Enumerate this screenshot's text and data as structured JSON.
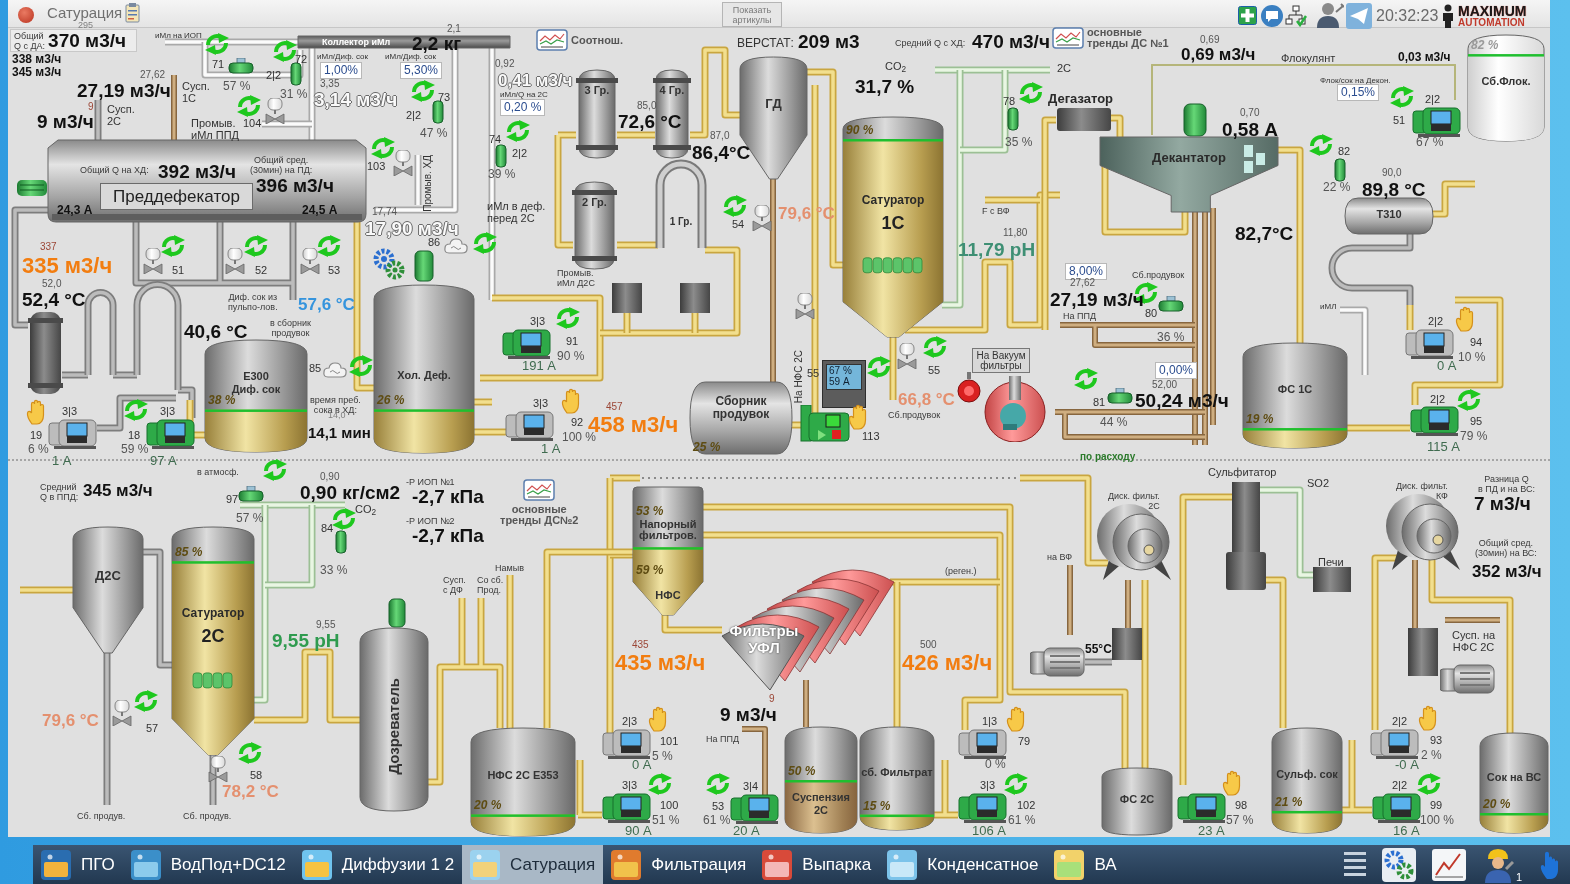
{
  "window": {
    "title": "Сатурация"
  },
  "header": {
    "articles_button": "Показать\nартикулы",
    "clock": "20:32:23",
    "logo": {
      "line_1": "MAXIMUM",
      "line_2": "AUTOMATION"
    }
  },
  "flow_panel": {
    "label": "Общий\nQ с ДА:",
    "value": "370 м3/ч"
  },
  "trend_buttons": [
    {
      "label": "Соотнош."
    },
    {
      "label": "основные\nтренды ДС №1"
    },
    {
      "label": "основные\nтренды ДС№2"
    }
  ],
  "vacuum_button": "На Вакуум\nфильтры",
  "labels": [
    {
      "text": "295",
      "kind": "ghost"
    },
    {
      "text": "338 м3/ч",
      "kind": "bold_small"
    },
    {
      "text": "345 м3/ч",
      "kind": "bold_small"
    },
    {
      "text": "иМл на ИОП",
      "kind": "tiny"
    },
    {
      "text": "2,1",
      "kind": "setpoint"
    },
    {
      "text": "2,2 кг",
      "kind": "value"
    },
    {
      "text": "иМл/Диф. сок",
      "kind": "tiny"
    },
    {
      "text": "1,00%",
      "kind": "ratio_box"
    },
    {
      "text": "иМл/Диф. сок",
      "kind": "tiny"
    },
    {
      "text": "5,30%",
      "kind": "ratio_box"
    },
    {
      "text": "3,35",
      "kind": "setpoint"
    },
    {
      "text": "3,14 м3/ч",
      "kind": "value_white"
    },
    {
      "text": "0,92",
      "kind": "setpoint"
    },
    {
      "text": "0,41 м3/ч",
      "kind": "value_white_medium"
    },
    {
      "text": "иМл/Q на 2С",
      "kind": "tiny"
    },
    {
      "text": "0,20 %",
      "kind": "ratio_box"
    },
    {
      "text": "27,62",
      "kind": "setpoint"
    },
    {
      "text": "27,19 м3/ч",
      "kind": "value"
    },
    {
      "text": "9",
      "kind": "setpoint_red"
    },
    {
      "text": "Сусп.\n1С",
      "kind": "caption"
    },
    {
      "text": "9 м3/ч",
      "kind": "value"
    },
    {
      "text": "Сусп.\n2С",
      "kind": "caption"
    },
    {
      "text": "Промыв.\nиМл ППД",
      "kind": "caption"
    },
    {
      "text": "Общий Q на ХД:",
      "kind": "note"
    },
    {
      "text": "392 м3/ч",
      "kind": "value"
    },
    {
      "text": "Общий сред.\n(30мин) на ПД:",
      "kind": "note"
    },
    {
      "text": "396 м3/ч",
      "kind": "value"
    },
    {
      "text": "24,3 А",
      "kind": "bold_small"
    },
    {
      "text": "24,5 А",
      "kind": "bold_small"
    },
    {
      "text": "Промыв. ХД",
      "kind": "vertical"
    },
    {
      "text": "17,74",
      "kind": "setpoint"
    },
    {
      "text": "17,90 м3/ч",
      "kind": "value_white"
    },
    {
      "text": "иМл в деф.\nперед 2С",
      "kind": "caption"
    },
    {
      "text": "337",
      "kind": "setpoint_red"
    },
    {
      "text": "335 м3/ч",
      "kind": "flow_orange"
    },
    {
      "text": "52,0",
      "kind": "setpoint"
    },
    {
      "text": "52,4 °С",
      "kind": "value"
    },
    {
      "text": "Диф. сок из\nпульпо-лов.",
      "kind": "note"
    },
    {
      "text": "57,6 °С",
      "kind": "temp_blue"
    },
    {
      "text": "40,6 °С",
      "kind": "value"
    },
    {
      "text": "в сборник\nпродувок",
      "kind": "note"
    },
    {
      "text": "время преб.\nсока в ХД:",
      "kind": "note"
    },
    {
      "text": "14,0",
      "kind": "ghost"
    },
    {
      "text": "14,1 мин",
      "kind": "value_small"
    },
    {
      "text": "ВЕРСТАТ:",
      "kind": "label"
    },
    {
      "text": "209 м3",
      "kind": "value"
    },
    {
      "text": "Средний Q с ХД:",
      "kind": "note"
    },
    {
      "text": "470 м3/ч",
      "kind": "value"
    },
    {
      "text": "CO$_{2}$",
      "kind": "caption"
    },
    {
      "text": "31,7 %",
      "kind": "value"
    },
    {
      "text": "85,0",
      "kind": "setpoint"
    },
    {
      "text": "72,6 °С",
      "kind": "value"
    },
    {
      "text": "87,0",
      "kind": "setpoint"
    },
    {
      "text": "86,4°С",
      "kind": "value"
    },
    {
      "text": "79,6 °С",
      "kind": "temp_salmon"
    },
    {
      "text": "Промыв.\nиМл Д2С",
      "kind": "note"
    },
    {
      "text": "457",
      "kind": "setpoint_red"
    },
    {
      "text": "458 м3/ч",
      "kind": "flow_orange"
    },
    {
      "text": "На НФС 2С",
      "kind": "vertical"
    },
    {
      "text": "66,8 °С",
      "kind": "temp_salmon"
    },
    {
      "text": "Сб.продувок",
      "kind": "note"
    },
    {
      "text": "F с ВФ",
      "kind": "note"
    },
    {
      "text": "11,80",
      "kind": "setpoint"
    },
    {
      "text": "11,79 pH",
      "kind": "ph_teal"
    },
    {
      "text": "2С",
      "kind": "caption"
    },
    {
      "text": "Дегазатор",
      "kind": "title_small"
    },
    {
      "text": "0,69",
      "kind": "setpoint"
    },
    {
      "text": "0,69 м3/ч",
      "kind": "value_medium"
    },
    {
      "text": "Флокулянт",
      "kind": "caption"
    },
    {
      "text": "0,03 м3/ч",
      "kind": "bold_small"
    },
    {
      "text": "Флок/сок на Декон.",
      "kind": "tiny"
    },
    {
      "text": "0,15%",
      "kind": "ratio_box"
    },
    {
      "text": "0,70",
      "kind": "setpoint"
    },
    {
      "text": "0,58 А",
      "kind": "value"
    },
    {
      "text": "90,0",
      "kind": "setpoint"
    },
    {
      "text": "89,8 °С",
      "kind": "value"
    },
    {
      "text": "82,7°С",
      "kind": "value"
    },
    {
      "text": "8,00%",
      "kind": "ratio_box"
    },
    {
      "text": "Сб.продувок",
      "kind": "note"
    },
    {
      "text": "27,62",
      "kind": "setpoint"
    },
    {
      "text": "27,19 м3/ч",
      "kind": "value"
    },
    {
      "text": "На ППД",
      "kind": "note"
    },
    {
      "text": "иМЛ",
      "kind": "tiny"
    },
    {
      "text": "0,00%",
      "kind": "ratio_box"
    },
    {
      "text": "52,00",
      "kind": "setpoint"
    },
    {
      "text": "50,24 м3/ч",
      "kind": "value"
    },
    {
      "text": "по расходу",
      "kind": "status"
    },
    {
      "text": "в атмосф.",
      "kind": "note"
    },
    {
      "text": "Средний\nQ в ППД:",
      "kind": "note"
    },
    {
      "text": "345 м3/ч",
      "kind": "value_medium"
    },
    {
      "text": "0,90",
      "kind": "setpoint"
    },
    {
      "text": "0,90 кг/см2",
      "kind": "value"
    },
    {
      "text": "CO$_{2}$",
      "kind": "caption"
    },
    {
      "text": "-Р ИОП №1",
      "kind": "note"
    },
    {
      "text": "-2,7 кПа",
      "kind": "value"
    },
    {
      "text": "-Р ИОП №2",
      "kind": "note"
    },
    {
      "text": "-2,7 кПа",
      "kind": "value"
    },
    {
      "text": "9,55",
      "kind": "setpoint"
    },
    {
      "text": "9,55 pH",
      "kind": "ph_green"
    },
    {
      "text": "79,6 °С",
      "kind": "temp_salmon"
    },
    {
      "text": "78,2 °С",
      "kind": "temp_salmon"
    },
    {
      "text": "Сб. продув.",
      "kind": "note"
    },
    {
      "text": "Сб. продув.",
      "kind": "note"
    },
    {
      "text": "Сусп.\nс ДФ",
      "kind": "note"
    },
    {
      "text": "Со сб.\nПрод.",
      "kind": "note"
    },
    {
      "text": "Намыв",
      "kind": "note"
    },
    {
      "text": "(реген.)",
      "kind": "note"
    },
    {
      "text": "435",
      "kind": "setpoint_red"
    },
    {
      "text": "435 м3/ч",
      "kind": "flow_orange"
    },
    {
      "text": "500",
      "kind": "setpoint"
    },
    {
      "text": "426 м3/ч",
      "kind": "flow_orange"
    },
    {
      "text": "9",
      "kind": "setpoint_red"
    },
    {
      "text": "9 м3/ч",
      "kind": "value"
    },
    {
      "text": "На ППД",
      "kind": "note"
    },
    {
      "text": "Сульфитатор",
      "kind": "caption"
    },
    {
      "text": "SO2",
      "kind": "caption"
    },
    {
      "text": "Печи",
      "kind": "caption"
    },
    {
      "text": "Диск. фильт.\n2С",
      "kind": "note"
    },
    {
      "text": "на ВФ",
      "kind": "note"
    },
    {
      "text": "55°С",
      "kind": "bold_small"
    },
    {
      "text": "Диск. фильт.\nКФ",
      "kind": "note"
    },
    {
      "text": "Разница Q\nв ПД и на ВС:",
      "kind": "note"
    },
    {
      "text": "7 м3/ч",
      "kind": "value"
    },
    {
      "text": "Общий сред.\n(30мин) на ВС:",
      "kind": "note"
    },
    {
      "text": "352 м3/ч",
      "kind": "value_medium"
    },
    {
      "text": "Сусп. на\nНФС 2С",
      "kind": "caption"
    }
  ],
  "vessels": [
    {
      "kind": "predefecator",
      "name": "Преддефекатор"
    },
    {
      "kind": "collector",
      "name": "Коллектор иМл"
    },
    {
      "kind": "tank",
      "name": "E300\nДиф. сок",
      "level_text": "38 %",
      "level": 0.38
    },
    {
      "kind": "tank",
      "name": "Хол. Деф.",
      "level_text": "26 %",
      "level": 0.26
    },
    {
      "kind": "heater",
      "name": "3 Гр."
    },
    {
      "kind": "heater",
      "name": "4 Гр."
    },
    {
      "kind": "heater",
      "name": "2 Гр."
    },
    {
      "kind": "u_tube",
      "name": "1 Гр."
    },
    {
      "kind": "cone",
      "name": "ГД"
    },
    {
      "kind": "saturator",
      "name": "Сатуратор",
      "subtitle": "1С",
      "level_text": "90 %",
      "level": 0.9
    },
    {
      "kind": "horizontal",
      "name": "Сборник\nпродувок",
      "level_text": "25 %"
    },
    {
      "kind": "decanter",
      "name": "Декантатор"
    },
    {
      "kind": "exchanger",
      "name": "Т310"
    },
    {
      "kind": "reagent_tank",
      "name": "Сб.Флок.",
      "level_text": "82 %",
      "level": 0.82
    },
    {
      "kind": "tank",
      "name": "ФС 1С",
      "level_text": "19 %",
      "level": 0.19
    },
    {
      "kind": "cone",
      "name": "Д2С"
    },
    {
      "kind": "saturator",
      "name": "Сатуратор",
      "subtitle": "2С",
      "level_text": "85 %",
      "level": 0.85
    },
    {
      "kind": "vertical_tank",
      "name": "Дозреватель"
    },
    {
      "kind": "tank",
      "name": "НФС 2С Е353",
      "level_text": "20 %",
      "level": 0.2
    },
    {
      "kind": "pressure_filter",
      "name": "Напорный\nфильтров.",
      "level_text": "53 %",
      "level": 0.53,
      "lower_name": "НФС",
      "lower_level_text": "59 %"
    },
    {
      "kind": "leaf_filters",
      "name": "Фильтры\nУФЛ"
    },
    {
      "kind": "slurry_tank",
      "name": "Суспензия\n2С",
      "level_text": "50 %",
      "level": 0.5
    },
    {
      "kind": "tank",
      "name": "сб. Фильтрат",
      "level_text": "15 %",
      "level": 0.15
    },
    {
      "kind": "tank",
      "name": "ФС 2С"
    },
    {
      "kind": "tank",
      "name": "Сульф. сок",
      "level_text": "21 %",
      "level": 0.21
    },
    {
      "kind": "tank",
      "name": "Сок на ВС",
      "level_text": "20 %",
      "level": 0.2
    }
  ],
  "pumps": [
    {
      "kind": "pump",
      "mode": "3|3",
      "number": "19",
      "output": "6 %",
      "current": "1 А",
      "running": false,
      "auto": false
    },
    {
      "kind": "pump",
      "mode": "3|3",
      "number": "18",
      "output": "59 %",
      "current": "97 А",
      "running": true,
      "auto": true
    },
    {
      "kind": "pump",
      "mode": "3|3",
      "number": "91",
      "output": "90 %",
      "current": "191 А",
      "running": true,
      "auto": true
    },
    {
      "kind": "pump",
      "mode": "3|3",
      "number": "92",
      "output": "100 %",
      "current": "1 А",
      "running": false,
      "auto": false
    },
    {
      "kind": "drive",
      "number": "113",
      "display_output": "67 %",
      "display_current": "59 А",
      "running": true,
      "auto": false
    },
    {
      "kind": "pump",
      "mode": "2|2",
      "number": "51",
      "output": "67 %",
      "running": true,
      "auto": true
    },
    {
      "kind": "pump",
      "mode": "2|2",
      "number": "94",
      "output": "10 %",
      "current": "0 А",
      "running": false,
      "auto": false
    },
    {
      "kind": "pump",
      "mode": "2|2",
      "number": "95",
      "output": "79 %",
      "current": "115 А",
      "running": true,
      "auto": true
    },
    {
      "kind": "pump",
      "mode": "2|3",
      "number": "101",
      "output": "5 %",
      "current": "0 А",
      "running": false,
      "auto": false
    },
    {
      "kind": "pump",
      "mode": "3|3",
      "number": "100",
      "output": "51 %",
      "current": "90 А",
      "running": true,
      "auto": true
    },
    {
      "kind": "pump",
      "mode": "3|4",
      "number": "53",
      "output": "61 %",
      "current": "20 А",
      "running": true,
      "auto": true
    },
    {
      "kind": "pump",
      "mode": "1|3",
      "number": "79",
      "output": "0 %",
      "running": false,
      "auto": false
    },
    {
      "kind": "pump",
      "mode": "3|3",
      "number": "102",
      "output": "61 %",
      "current": "106 А",
      "running": true,
      "auto": true
    },
    {
      "kind": "pump",
      "number": "98",
      "output": "57 %",
      "current": "23 А",
      "running": true,
      "auto": false
    },
    {
      "kind": "pump",
      "mode": "2|2",
      "number": "93",
      "output": "2 %",
      "current": "-0 А",
      "running": false,
      "auto": false
    },
    {
      "kind": "pump",
      "mode": "2|2",
      "number": "99",
      "output": "100 %",
      "current": "16 А",
      "running": true,
      "auto": true
    }
  ],
  "valves": [
    {
      "kind": "flowmeter",
      "number": "71",
      "percent": "57 %",
      "auto": true
    },
    {
      "kind": "flowmeter_vertical",
      "mode": "2|2",
      "number": "72",
      "percent": "31 %",
      "auto": true
    },
    {
      "kind": "flowmeter_vertical",
      "mode": "2|2",
      "number": "73",
      "percent": "47 %",
      "auto": true
    },
    {
      "kind": "flowmeter_vertical",
      "mode": "2|2",
      "number": "74",
      "percent": "39 %",
      "auto": true
    },
    {
      "kind": "valve",
      "number": "104",
      "auto": true
    },
    {
      "kind": "valve",
      "number": "103",
      "auto": true
    },
    {
      "kind": "valve",
      "number": "51",
      "auto": true
    },
    {
      "kind": "valve",
      "number": "52",
      "auto": true
    },
    {
      "kind": "valve",
      "number": "53",
      "auto": true
    },
    {
      "kind": "sensor",
      "number": "86",
      "auto": true
    },
    {
      "kind": "sensor",
      "number": "85",
      "auto": true
    },
    {
      "kind": "valve",
      "number": "54",
      "auto": true
    },
    {
      "kind": "valve",
      "number": "55",
      "auto": true
    },
    {
      "kind": "valve",
      "number": "55",
      "auto": true
    },
    {
      "kind": "flowmeter_vertical",
      "number": "78",
      "percent": "35 %",
      "auto": true
    },
    {
      "kind": "flowmeter_vertical",
      "number": "82",
      "percent": "22 %",
      "auto": true
    },
    {
      "kind": "flowmeter",
      "number": "80",
      "percent": "36 %",
      "auto": true
    },
    {
      "kind": "flowmeter",
      "number": "81",
      "percent": "44 %",
      "auto": true
    },
    {
      "kind": "flowmeter",
      "number": "97",
      "percent": "57 %",
      "auto": true
    },
    {
      "kind": "flowmeter_vertical",
      "number": "84",
      "percent": "33 %",
      "auto": true
    },
    {
      "kind": "valve",
      "number": "57",
      "auto": true
    },
    {
      "kind": "valve",
      "number": "58",
      "auto": true
    }
  ],
  "taskbar": {
    "items": [
      {
        "label": "ПГО",
        "selected": false
      },
      {
        "label": "ВодПод+DC12",
        "selected": false
      },
      {
        "label": "Диффузии 1 2",
        "selected": false
      },
      {
        "label": "Сатурация",
        "selected": true
      },
      {
        "label": "Фильтрация",
        "selected": false
      },
      {
        "label": "Выпарка",
        "selected": false
      },
      {
        "label": "Конденсатное",
        "selected": false
      },
      {
        "label": "ВА",
        "selected": false
      }
    ],
    "user_badge": "1"
  }
}
